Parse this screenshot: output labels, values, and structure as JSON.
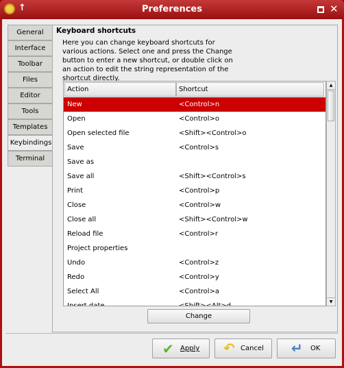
{
  "window": {
    "title": "Preferences"
  },
  "tabs": [
    "General",
    "Interface",
    "Toolbar",
    "Files",
    "Editor",
    "Tools",
    "Templates",
    "Keybindings",
    "Terminal"
  ],
  "active_tab": "Keybindings",
  "section": {
    "title": "Keyboard shortcuts",
    "description": "Here you can change keyboard shortcuts for various actions. Select one and press the Change button to enter a new shortcut, or double click on an action to edit the string representation of the shortcut directly."
  },
  "table": {
    "columns": [
      "Action",
      "Shortcut"
    ],
    "rows": [
      [
        "New",
        "<Control>n"
      ],
      [
        "Open",
        "<Control>o"
      ],
      [
        "Open selected file",
        "<Shift><Control>o"
      ],
      [
        "Save",
        "<Control>s"
      ],
      [
        "Save as",
        ""
      ],
      [
        "Save all",
        "<Shift><Control>s"
      ],
      [
        "Print",
        "<Control>p"
      ],
      [
        "Close",
        "<Control>w"
      ],
      [
        "Close all",
        "<Shift><Control>w"
      ],
      [
        "Reload file",
        "<Control>r"
      ],
      [
        "Project properties",
        ""
      ],
      [
        "Undo",
        "<Control>z"
      ],
      [
        "Redo",
        "<Control>y"
      ],
      [
        "Select All",
        "<Control>a"
      ],
      [
        "Insert date",
        "<Shift><Alt>d"
      ]
    ],
    "selected_row": 0
  },
  "change_button": "Change",
  "buttons": {
    "apply": "Apply",
    "cancel": "Cancel",
    "ok": "OK"
  }
}
